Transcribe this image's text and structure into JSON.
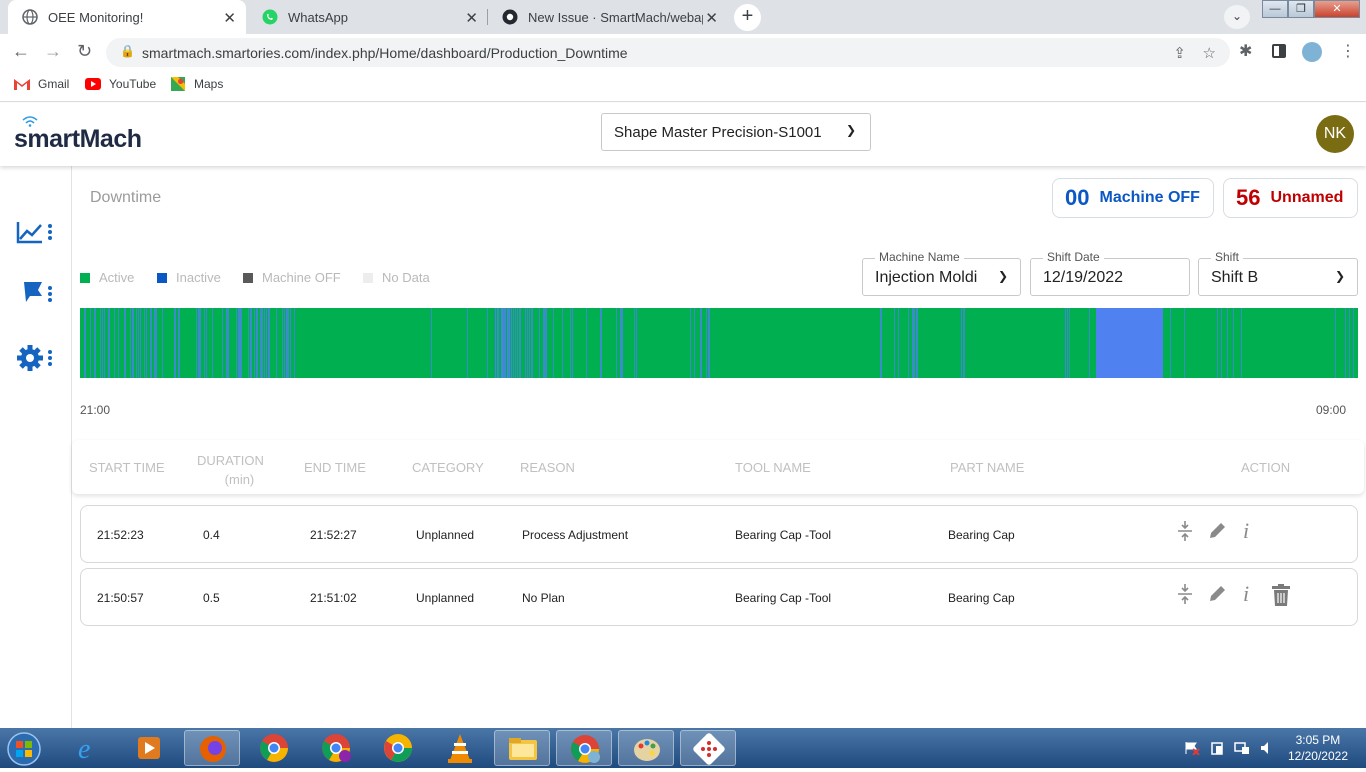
{
  "browser": {
    "tabs": [
      {
        "title": "OEE Monitoring!",
        "active": true
      },
      {
        "title": "WhatsApp",
        "active": false
      },
      {
        "title": "New Issue · SmartMach/webapp·",
        "active": false
      }
    ],
    "url": "smartmach.smartories.com/index.php/Home/dashboard/Production_Downtime",
    "bookmarks": [
      {
        "label": "Gmail",
        "icon": "gmail-icon"
      },
      {
        "label": "YouTube",
        "icon": "youtube-icon"
      },
      {
        "label": "Maps",
        "icon": "maps-icon"
      }
    ]
  },
  "app": {
    "logo": "smartMach",
    "machine_selector": "Shape Master Precision-S1001",
    "avatar": "NK",
    "page_title": "Downtime",
    "counters": [
      {
        "value": "00",
        "label": "Machine OFF",
        "color": "#0b57c5"
      },
      {
        "value": "56",
        "label": "Unnamed",
        "color": "#c00000"
      }
    ],
    "legend": [
      {
        "label": "Active",
        "color": "#00b050"
      },
      {
        "label": "Inactive",
        "color": "#0b57c5"
      },
      {
        "label": "Machine OFF",
        "color": "#595959"
      },
      {
        "label": "No Data",
        "color": "#ededed"
      }
    ],
    "filters": {
      "machine_name": {
        "label": "Machine Name",
        "value": "Injection Moldi"
      },
      "shift_date": {
        "label": "Shift Date",
        "value": "12/19/2022"
      },
      "shift": {
        "label": "Shift",
        "value": "Shift B"
      }
    },
    "timeline": {
      "start": "21:00",
      "end": "09:00",
      "active_color": "#00b050",
      "inactive_color": "#4f81f0"
    },
    "table": {
      "headers": {
        "start_time": "START TIME",
        "duration": "DURATION",
        "duration_unit": "(min)",
        "end_time": "END TIME",
        "category": "CATEGORY",
        "reason": "REASON",
        "tool_name": "TOOL NAME",
        "part_name": "PART NAME",
        "action": "ACTION"
      },
      "rows": [
        {
          "start": "21:52:23",
          "duration": "0.4",
          "end": "21:52:27",
          "category": "Unplanned",
          "reason": "Process Adjustment",
          "tool": "Bearing Cap -Tool",
          "part": "Bearing Cap"
        },
        {
          "start": "21:50:57",
          "duration": "0.5",
          "end": "21:51:02",
          "category": "Unplanned",
          "reason": "No Plan",
          "tool": "Bearing Cap -Tool",
          "part": "Bearing Cap"
        }
      ]
    }
  },
  "taskbar": {
    "time": "3:05 PM",
    "date": "12/20/2022"
  }
}
